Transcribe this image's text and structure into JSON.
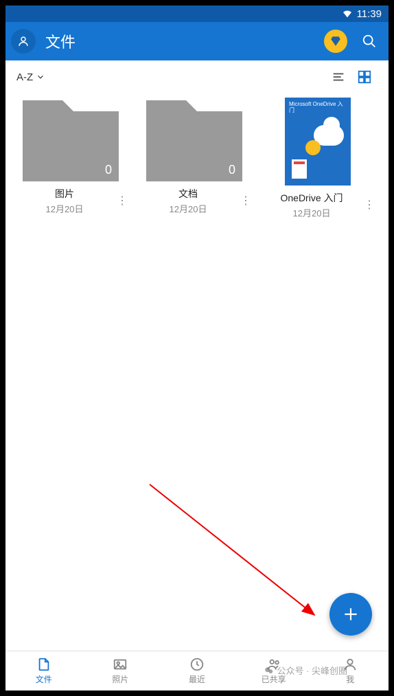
{
  "status": {
    "time": "11:39"
  },
  "appbar": {
    "title": "文件"
  },
  "sort": {
    "label": "A-Z"
  },
  "items": [
    {
      "type": "folder",
      "name": "图片",
      "date": "12月20日",
      "count": "0"
    },
    {
      "type": "folder",
      "name": "文档",
      "date": "12月20日",
      "count": "0"
    },
    {
      "type": "document",
      "name": "OneDrive 入门",
      "date": "12月20日",
      "doc_heading": "Microsoft OneDrive 入门"
    }
  ],
  "nav": {
    "files": "文件",
    "photos": "照片",
    "recent": "最近",
    "shared": "已共享",
    "me": "我"
  },
  "watermark": {
    "text": "公众号 · 尖峰创圈"
  },
  "colors": {
    "primary": "#1575d1",
    "accent": "#f9be1f"
  }
}
